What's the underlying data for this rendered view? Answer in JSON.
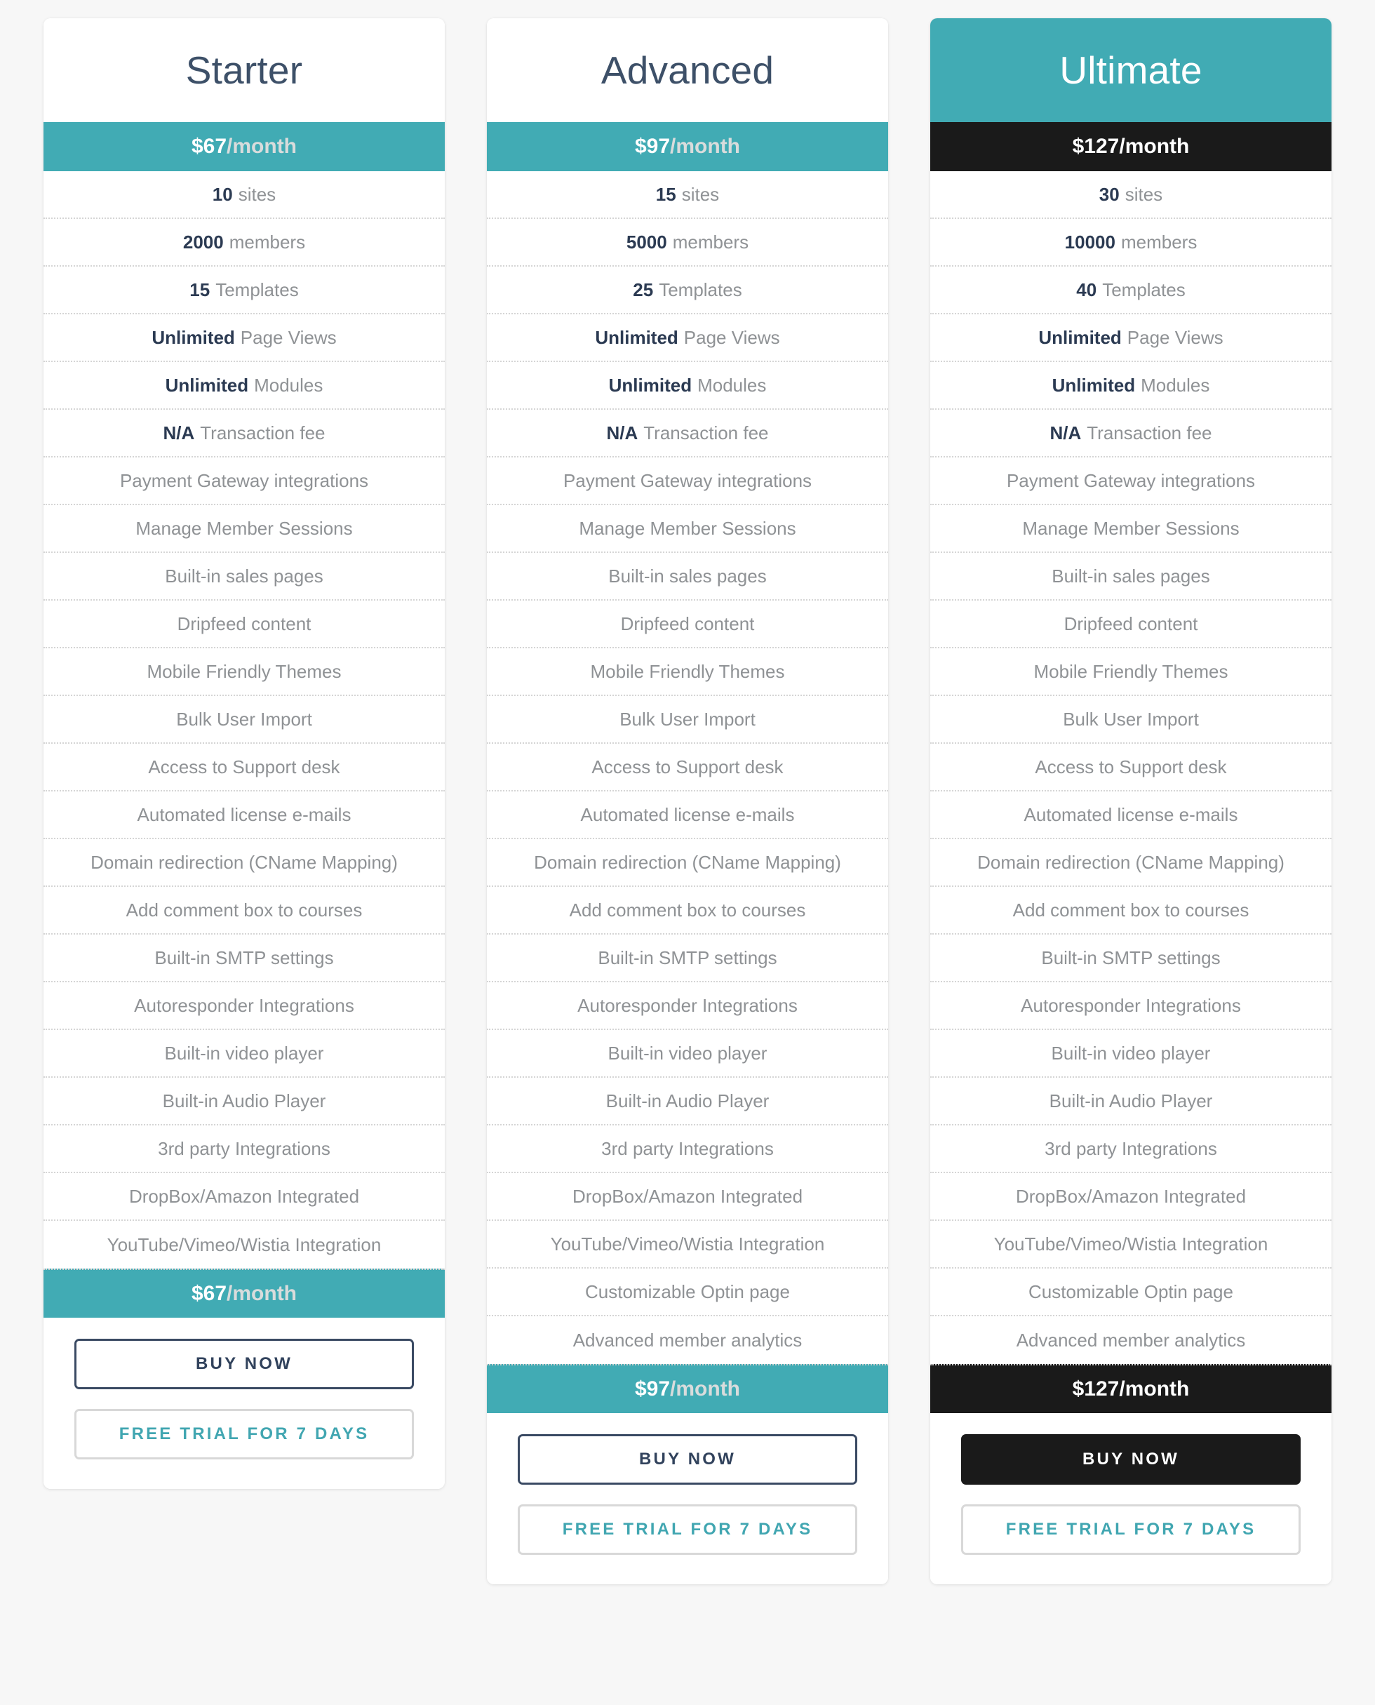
{
  "page": {
    "clipped_heading": "",
    "background_color": "#f7f7f7",
    "accent_teal": "#41abb4",
    "accent_navy": "#3d5068",
    "accent_dark": "#1a1a1a",
    "muted_text": "#8f9295"
  },
  "plans": [
    {
      "name": "Starter",
      "price_amount": "$67",
      "price_period": "/month",
      "featured": false,
      "dark_band": false,
      "buy_label": "BUY NOW",
      "trial_label": "FREE TRIAL FOR 7 DAYS",
      "features": [
        {
          "strong": "10",
          "text": "sites"
        },
        {
          "strong": "2000",
          "text": "members"
        },
        {
          "strong": "15",
          "text": "Templates"
        },
        {
          "strong": "Unlimited",
          "text": "Page Views"
        },
        {
          "strong": "Unlimited",
          "text": "Modules"
        },
        {
          "strong": "N/A",
          "text": "Transaction fee"
        },
        {
          "strong": "",
          "text": "Payment Gateway integrations"
        },
        {
          "strong": "",
          "text": "Manage Member Sessions"
        },
        {
          "strong": "",
          "text": "Built-in sales pages"
        },
        {
          "strong": "",
          "text": "Dripfeed content"
        },
        {
          "strong": "",
          "text": "Mobile Friendly Themes"
        },
        {
          "strong": "",
          "text": "Bulk User Import"
        },
        {
          "strong": "",
          "text": "Access to Support desk"
        },
        {
          "strong": "",
          "text": "Automated license e-mails"
        },
        {
          "strong": "",
          "text": "Domain redirection (CName Mapping)"
        },
        {
          "strong": "",
          "text": "Add comment box to courses"
        },
        {
          "strong": "",
          "text": "Built-in SMTP settings"
        },
        {
          "strong": "",
          "text": "Autoresponder Integrations"
        },
        {
          "strong": "",
          "text": "Built-in video player"
        },
        {
          "strong": "",
          "text": "Built-in Audio Player"
        },
        {
          "strong": "",
          "text": "3rd party Integrations"
        },
        {
          "strong": "",
          "text": "DropBox/Amazon Integrated"
        },
        {
          "strong": "",
          "text": "YouTube/Vimeo/Wistia Integration"
        }
      ]
    },
    {
      "name": "Advanced",
      "price_amount": "$97",
      "price_period": "/month",
      "featured": false,
      "dark_band": false,
      "buy_label": "BUY NOW",
      "trial_label": "FREE TRIAL FOR 7 DAYS",
      "features": [
        {
          "strong": "15",
          "text": "sites"
        },
        {
          "strong": "5000",
          "text": "members"
        },
        {
          "strong": "25",
          "text": "Templates"
        },
        {
          "strong": "Unlimited",
          "text": "Page Views"
        },
        {
          "strong": "Unlimited",
          "text": "Modules"
        },
        {
          "strong": "N/A",
          "text": "Transaction fee"
        },
        {
          "strong": "",
          "text": "Payment Gateway integrations"
        },
        {
          "strong": "",
          "text": "Manage Member Sessions"
        },
        {
          "strong": "",
          "text": "Built-in sales pages"
        },
        {
          "strong": "",
          "text": "Dripfeed content"
        },
        {
          "strong": "",
          "text": "Mobile Friendly Themes"
        },
        {
          "strong": "",
          "text": "Bulk User Import"
        },
        {
          "strong": "",
          "text": "Access to Support desk"
        },
        {
          "strong": "",
          "text": "Automated license e-mails"
        },
        {
          "strong": "",
          "text": "Domain redirection (CName Mapping)"
        },
        {
          "strong": "",
          "text": "Add comment box to courses"
        },
        {
          "strong": "",
          "text": "Built-in SMTP settings"
        },
        {
          "strong": "",
          "text": "Autoresponder Integrations"
        },
        {
          "strong": "",
          "text": "Built-in video player"
        },
        {
          "strong": "",
          "text": "Built-in Audio Player"
        },
        {
          "strong": "",
          "text": "3rd party Integrations"
        },
        {
          "strong": "",
          "text": "DropBox/Amazon Integrated"
        },
        {
          "strong": "",
          "text": "YouTube/Vimeo/Wistia Integration"
        },
        {
          "strong": "",
          "text": "Customizable Optin page"
        },
        {
          "strong": "",
          "text": "Advanced member analytics"
        }
      ]
    },
    {
      "name": "Ultimate",
      "price_amount": "$127",
      "price_period": "/month",
      "featured": true,
      "dark_band": true,
      "buy_label": "BUY NOW",
      "trial_label": "FREE TRIAL FOR 7 DAYS",
      "features": [
        {
          "strong": "30",
          "text": "sites"
        },
        {
          "strong": "10000",
          "text": "members"
        },
        {
          "strong": "40",
          "text": "Templates"
        },
        {
          "strong": "Unlimited",
          "text": "Page Views"
        },
        {
          "strong": "Unlimited",
          "text": "Modules"
        },
        {
          "strong": "N/A",
          "text": "Transaction fee"
        },
        {
          "strong": "",
          "text": "Payment Gateway integrations"
        },
        {
          "strong": "",
          "text": "Manage Member Sessions"
        },
        {
          "strong": "",
          "text": "Built-in sales pages"
        },
        {
          "strong": "",
          "text": "Dripfeed content"
        },
        {
          "strong": "",
          "text": "Mobile Friendly Themes"
        },
        {
          "strong": "",
          "text": "Bulk User Import"
        },
        {
          "strong": "",
          "text": "Access to Support desk"
        },
        {
          "strong": "",
          "text": "Automated license e-mails"
        },
        {
          "strong": "",
          "text": "Domain redirection (CName Mapping)"
        },
        {
          "strong": "",
          "text": "Add comment box to courses"
        },
        {
          "strong": "",
          "text": "Built-in SMTP settings"
        },
        {
          "strong": "",
          "text": "Autoresponder Integrations"
        },
        {
          "strong": "",
          "text": "Built-in video player"
        },
        {
          "strong": "",
          "text": "Built-in Audio Player"
        },
        {
          "strong": "",
          "text": "3rd party Integrations"
        },
        {
          "strong": "",
          "text": "DropBox/Amazon Integrated"
        },
        {
          "strong": "",
          "text": "YouTube/Vimeo/Wistia Integration"
        },
        {
          "strong": "",
          "text": "Customizable Optin page"
        },
        {
          "strong": "",
          "text": "Advanced member analytics"
        }
      ]
    }
  ]
}
